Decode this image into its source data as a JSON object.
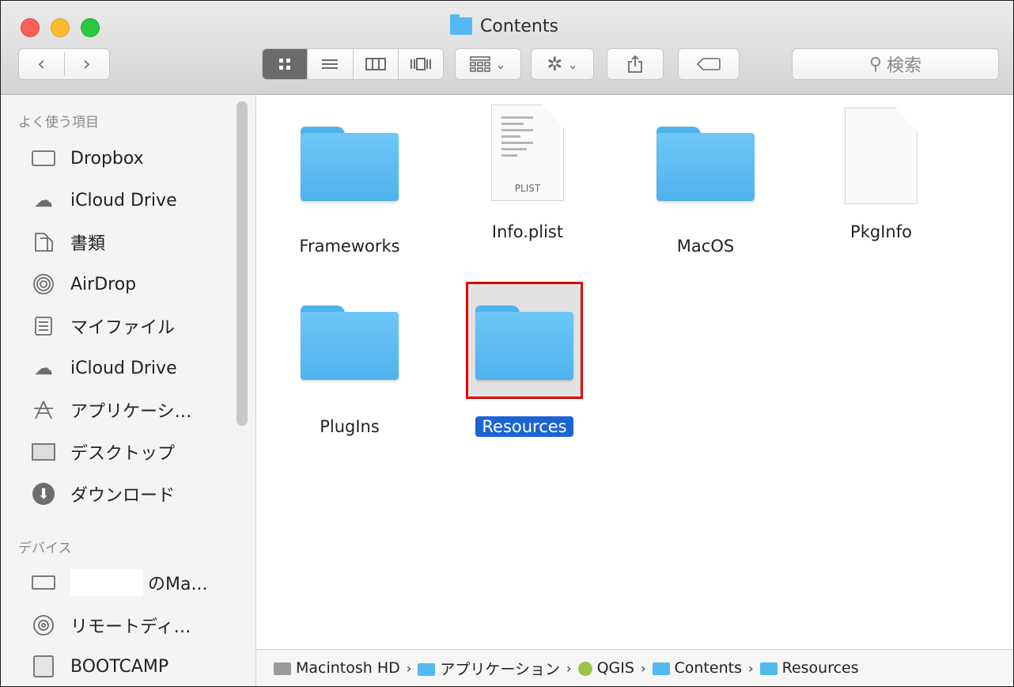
{
  "window": {
    "title": "Contents"
  },
  "toolbar": {
    "back_icon": "‹",
    "forward_icon": "›",
    "view_icons": [
      "icon-view-icon",
      "list-view-icon",
      "column-view-icon",
      "cover-flow-icon"
    ],
    "search_placeholder": "検索"
  },
  "sidebar": {
    "favorites_header": "よく使う項目",
    "favorites": [
      {
        "label": "Dropbox",
        "icon": "folder-icon"
      },
      {
        "label": "iCloud Drive",
        "icon": "cloud-icon"
      },
      {
        "label": "書類",
        "icon": "documents-icon"
      },
      {
        "label": "AirDrop",
        "icon": "airdrop-icon"
      },
      {
        "label": "マイファイル",
        "icon": "all-files-icon"
      },
      {
        "label": "iCloud Drive",
        "icon": "cloud-icon"
      },
      {
        "label": "アプリケーシ…",
        "icon": "applications-icon"
      },
      {
        "label": "デスクトップ",
        "icon": "desktop-icon"
      },
      {
        "label": "ダウンロード",
        "icon": "download-icon"
      }
    ],
    "devices_header": "デバイス",
    "devices": [
      {
        "label": "のMa...",
        "icon": "laptop-icon"
      },
      {
        "label": "リモートディ…",
        "icon": "remote-disc-icon"
      },
      {
        "label": "BOOTCAMP",
        "icon": "disk-icon"
      }
    ]
  },
  "files": [
    {
      "name": "Frameworks",
      "kind": "folder"
    },
    {
      "name": "Info.plist",
      "kind": "plist",
      "badge": "PLIST"
    },
    {
      "name": "MacOS",
      "kind": "folder"
    },
    {
      "name": "PkgInfo",
      "kind": "document"
    },
    {
      "name": "PlugIns",
      "kind": "folder"
    },
    {
      "name": "Resources",
      "kind": "folder",
      "selected": true
    }
  ],
  "pathbar": [
    {
      "label": "Macintosh HD",
      "icon": "disk-icon"
    },
    {
      "label": "アプリケーション",
      "icon": "folder-icon"
    },
    {
      "label": "QGIS",
      "icon": "qgis-icon"
    },
    {
      "label": "Contents",
      "icon": "folder-icon"
    },
    {
      "label": "Resources",
      "icon": "folder-icon"
    }
  ],
  "colors": {
    "selection": "#1c64d4",
    "highlight_frame": "#e10000",
    "folder": "#55b8f0"
  }
}
